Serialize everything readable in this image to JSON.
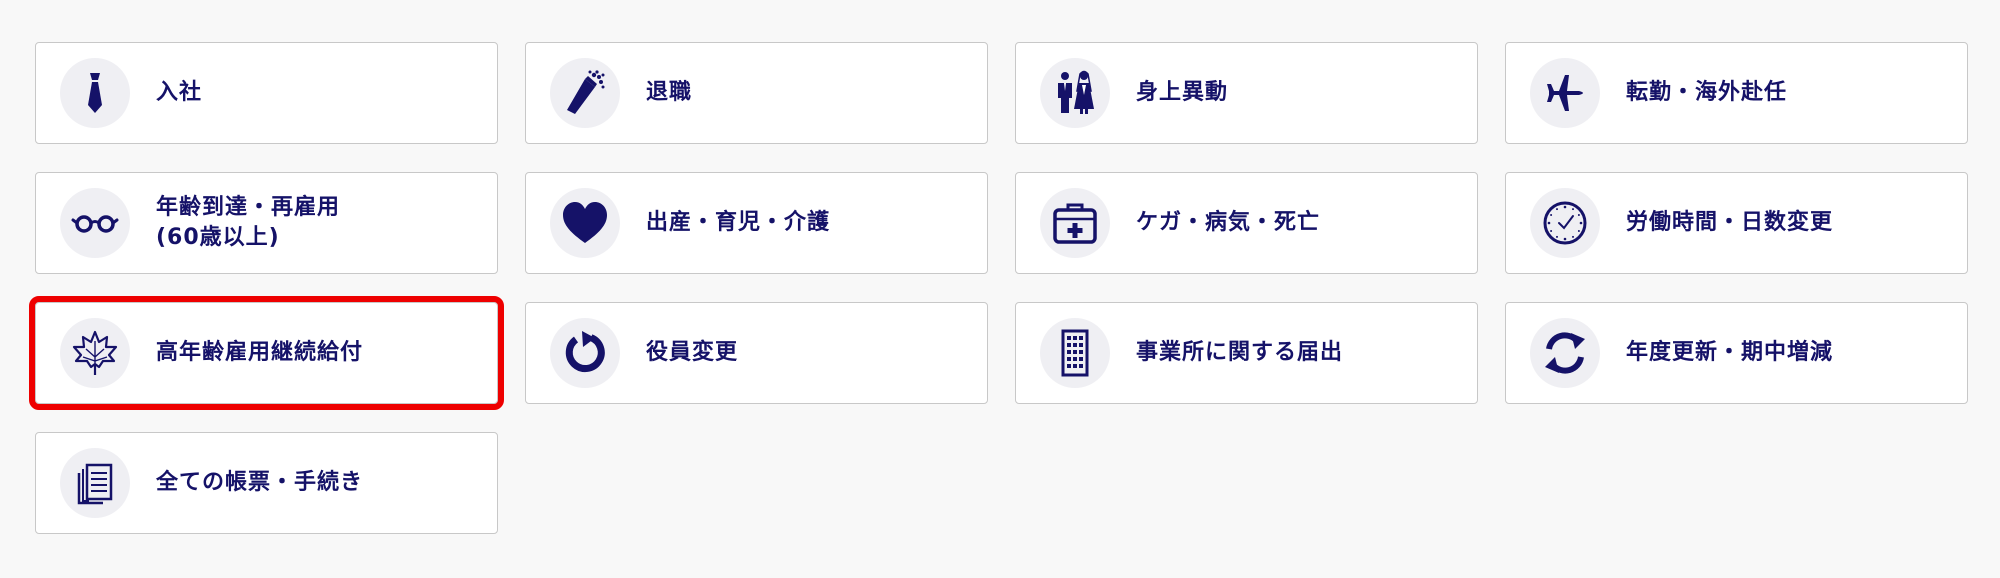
{
  "colors": {
    "accent": "#151268",
    "icon_background": "#efeff3",
    "card_border": "#c8c8c8",
    "selection_outline": "#ee0000",
    "page_background": "#f8f8f8"
  },
  "procedures": [
    {
      "label": "入社",
      "icon": "necktie-icon"
    },
    {
      "label": "退職",
      "icon": "bouquet-icon"
    },
    {
      "label": "身上異動",
      "icon": "wedding-couple-icon"
    },
    {
      "label": "転勤・海外赴任",
      "icon": "airplane-icon"
    },
    {
      "label": "年齢到達・再雇用\n(60歳以上)",
      "icon": "glasses-icon"
    },
    {
      "label": "出産・育児・介護",
      "icon": "heart-icon"
    },
    {
      "label": "ケガ・病気・死亡",
      "icon": "first-aid-kit-icon"
    },
    {
      "label": "労働時間・日数変更",
      "icon": "clock-icon"
    },
    {
      "label": "高年齢雇用継続給付",
      "icon": "maple-leaf-icon",
      "selected": true
    },
    {
      "label": "役員変更",
      "icon": "refresh-icon"
    },
    {
      "label": "事業所に関する届出",
      "icon": "office-building-icon"
    },
    {
      "label": "年度更新・期中増減",
      "icon": "sync-arrows-icon"
    },
    {
      "label": "全ての帳票・手続き",
      "icon": "documents-icon"
    }
  ]
}
